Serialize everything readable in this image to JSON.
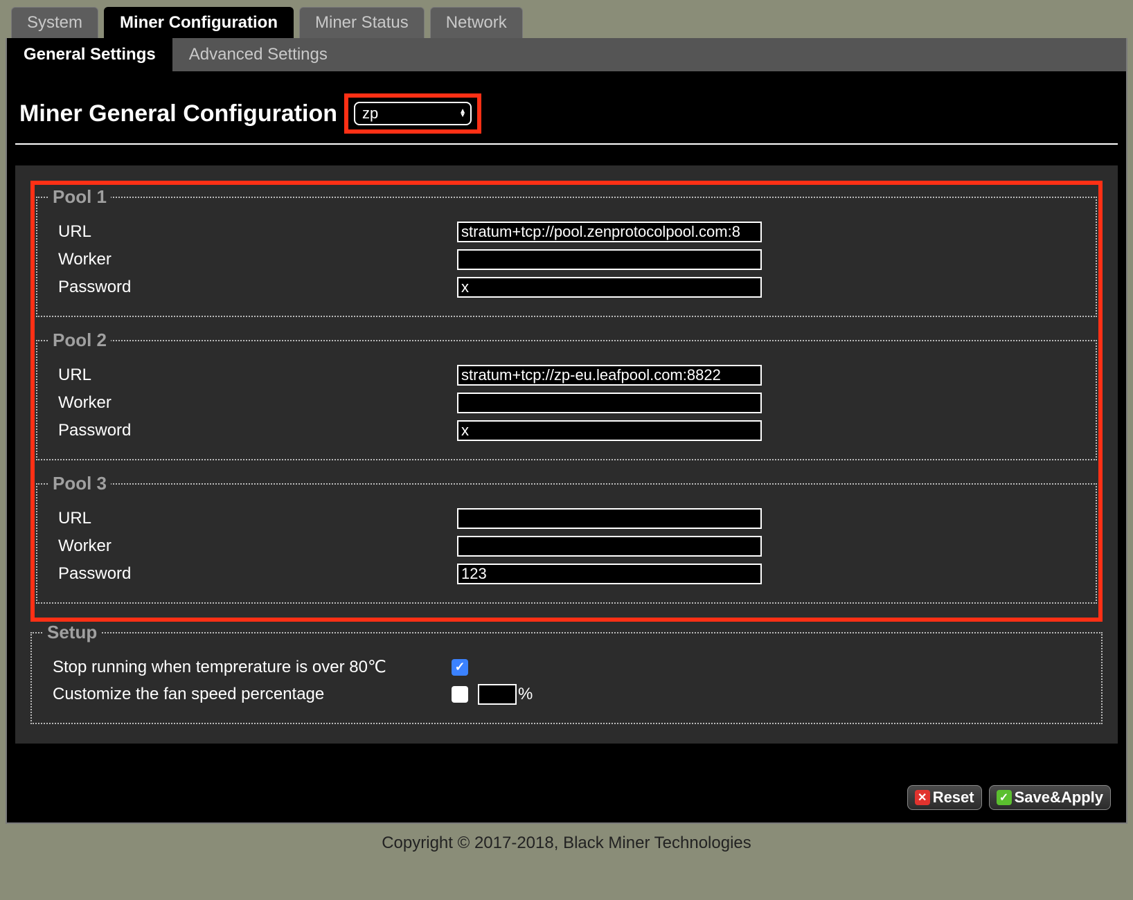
{
  "tabs": {
    "system": "System",
    "miner_config": "Miner Configuration",
    "miner_status": "Miner Status",
    "network": "Network"
  },
  "subtabs": {
    "general": "General Settings",
    "advanced": "Advanced Settings"
  },
  "page_title": "Miner General Configuration",
  "algo_select": "zp",
  "pools": [
    {
      "legend": "Pool 1",
      "url_label": "URL",
      "url": "stratum+tcp://pool.zenprotocolpool.com:8",
      "worker_label": "Worker",
      "worker": "",
      "password_label": "Password",
      "password": "x"
    },
    {
      "legend": "Pool 2",
      "url_label": "URL",
      "url": "stratum+tcp://zp-eu.leafpool.com:8822",
      "worker_label": "Worker",
      "worker": "",
      "password_label": "Password",
      "password": "x"
    },
    {
      "legend": "Pool 3",
      "url_label": "URL",
      "url": "",
      "worker_label": "Worker",
      "worker": "",
      "password_label": "Password",
      "password": "123"
    }
  ],
  "setup": {
    "legend": "Setup",
    "temp_label": "Stop running when temprerature is over 80℃",
    "temp_checked": true,
    "fan_label": "Customize the fan speed percentage",
    "fan_checked": false,
    "fan_value": "",
    "percent": "%"
  },
  "buttons": {
    "reset": "Reset",
    "save": "Save&Apply"
  },
  "footer": "Copyright © 2017-2018, Black Miner Technologies"
}
